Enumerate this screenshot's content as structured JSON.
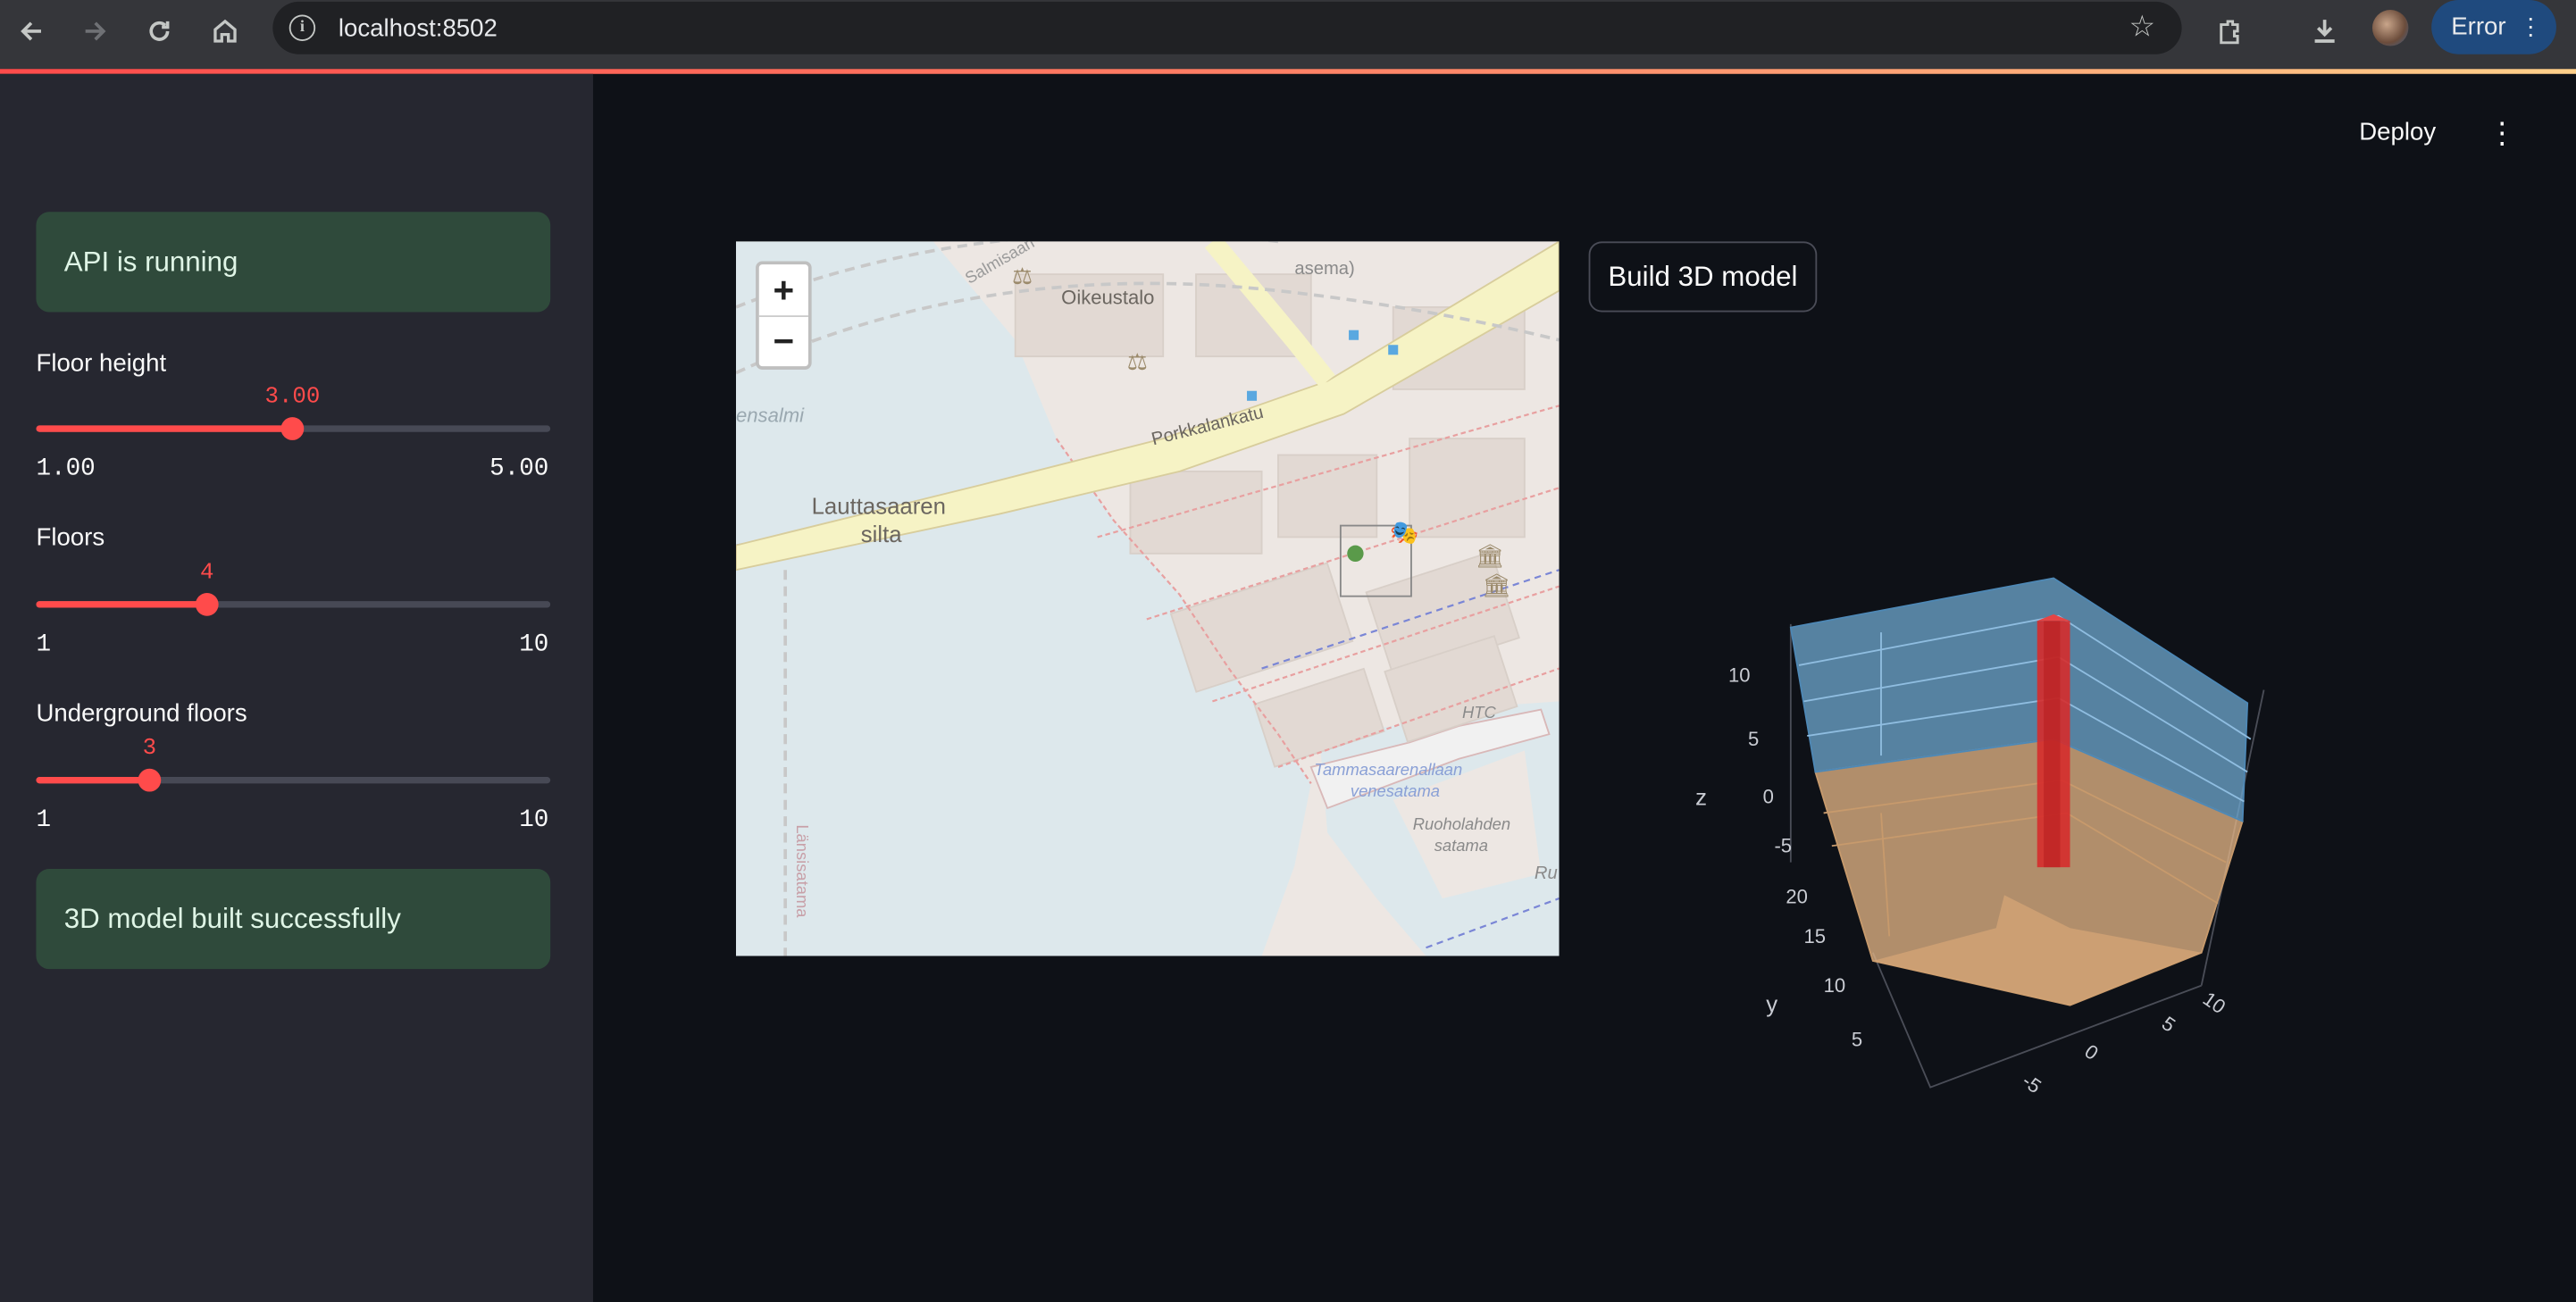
{
  "browser": {
    "url": "localhost:8502",
    "error_label": "Error"
  },
  "sidebar": {
    "api_status": "API is running",
    "sliders": [
      {
        "label": "Floor height",
        "value": "3.00",
        "min": "1.00",
        "max": "5.00",
        "fraction": 0.5
      },
      {
        "label": "Floors",
        "value": "4",
        "min": "1",
        "max": "10",
        "fraction": 0.333
      },
      {
        "label": "Underground floors",
        "value": "3",
        "min": "1",
        "max": "10",
        "fraction": 0.222
      }
    ],
    "build_status": "3D model built successfully"
  },
  "header": {
    "deploy_label": "Deploy"
  },
  "main": {
    "build_button_label": "Build 3D model"
  },
  "map": {
    "zoom_in": "+",
    "zoom_out": "−",
    "labels": {
      "oikeustalo": "Oikeustalo",
      "lauttasaaren_silta_1": "Lauttasaaren",
      "lauttasaaren_silta_2": "silta",
      "porkkalankatu": "Porkkalankatu",
      "ensalmi": "ensalmi",
      "htc": "HTC",
      "marina_1": "Tammasaarenallaan",
      "marina_2": "venesatama",
      "ruoholahden_1": "Ruoholahden",
      "ruoholahden_2": "satama",
      "lansisatama": "Länsisatama",
      "salmisaari": "Salmisaari",
      "asema": "asema)",
      "ru": "Ru"
    },
    "colors": {
      "water": "#dde8ec",
      "land": "#ede7e3",
      "road": "#f6f3c5"
    }
  },
  "plot3d": {
    "axis_labels": {
      "z": "z",
      "y": "y"
    },
    "z_ticks": [
      "10",
      "5",
      "0",
      "-5"
    ],
    "y_ticks": [
      "20",
      "15",
      "10",
      "5"
    ],
    "x_ticks": [
      "10",
      "5",
      "0",
      "-5"
    ],
    "colors": {
      "above_ground": "#6fa8d0",
      "underground": "#e8b888",
      "column": "#d62c2c"
    }
  }
}
